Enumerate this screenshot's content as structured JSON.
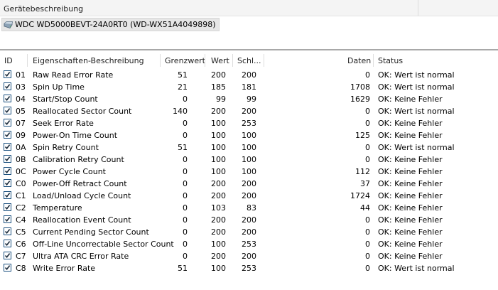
{
  "header": {
    "title": "Gerätebeschreibung"
  },
  "device": {
    "name": "WDC WD5000BEVT-24A0RT0 (WD-WX51A4049898)",
    "icon": "hard-drive-icon"
  },
  "columns": {
    "id": "ID",
    "description": "Eigenschaften-Beschreibung",
    "threshold": "Grenzwert",
    "value": "Wert",
    "worst": "Schl...",
    "data": "Daten",
    "status": "Status"
  },
  "rows": [
    {
      "id": "01",
      "desc": "Raw Read Error Rate",
      "thr": "51",
      "val": "200",
      "worst": "200",
      "data": "0",
      "status": "OK: Wert ist normal",
      "checked": true
    },
    {
      "id": "03",
      "desc": "Spin Up Time",
      "thr": "21",
      "val": "185",
      "worst": "181",
      "data": "1708",
      "status": "OK: Wert ist normal",
      "checked": true
    },
    {
      "id": "04",
      "desc": "Start/Stop Count",
      "thr": "0",
      "val": "99",
      "worst": "99",
      "data": "1629",
      "status": "OK: Keine Fehler",
      "checked": true
    },
    {
      "id": "05",
      "desc": "Reallocated Sector Count",
      "thr": "140",
      "val": "200",
      "worst": "200",
      "data": "0",
      "status": "OK: Wert ist normal",
      "checked": true
    },
    {
      "id": "07",
      "desc": "Seek Error Rate",
      "thr": "0",
      "val": "100",
      "worst": "253",
      "data": "0",
      "status": "OK: Keine Fehler",
      "checked": true
    },
    {
      "id": "09",
      "desc": "Power-On Time Count",
      "thr": "0",
      "val": "100",
      "worst": "100",
      "data": "125",
      "status": "OK: Keine Fehler",
      "checked": true
    },
    {
      "id": "0A",
      "desc": "Spin Retry Count",
      "thr": "51",
      "val": "100",
      "worst": "100",
      "data": "0",
      "status": "OK: Wert ist normal",
      "checked": true
    },
    {
      "id": "0B",
      "desc": "Calibration Retry Count",
      "thr": "0",
      "val": "100",
      "worst": "100",
      "data": "0",
      "status": "OK: Keine Fehler",
      "checked": true
    },
    {
      "id": "0C",
      "desc": "Power Cycle Count",
      "thr": "0",
      "val": "100",
      "worst": "100",
      "data": "112",
      "status": "OK: Keine Fehler",
      "checked": true
    },
    {
      "id": "C0",
      "desc": "Power-Off Retract Count",
      "thr": "0",
      "val": "200",
      "worst": "200",
      "data": "37",
      "status": "OK: Keine Fehler",
      "checked": true
    },
    {
      "id": "C1",
      "desc": "Load/Unload Cycle Count",
      "thr": "0",
      "val": "200",
      "worst": "200",
      "data": "1724",
      "status": "OK: Keine Fehler",
      "checked": true
    },
    {
      "id": "C2",
      "desc": "Temperature",
      "thr": "0",
      "val": "103",
      "worst": "83",
      "data": "44",
      "status": "OK: Keine Fehler",
      "checked": true
    },
    {
      "id": "C4",
      "desc": "Reallocation Event Count",
      "thr": "0",
      "val": "200",
      "worst": "200",
      "data": "0",
      "status": "OK: Keine Fehler",
      "checked": true
    },
    {
      "id": "C5",
      "desc": "Current Pending Sector Count",
      "thr": "0",
      "val": "200",
      "worst": "200",
      "data": "0",
      "status": "OK: Keine Fehler",
      "checked": true
    },
    {
      "id": "C6",
      "desc": "Off-Line Uncorrectable Sector Count",
      "thr": "0",
      "val": "100",
      "worst": "253",
      "data": "0",
      "status": "OK: Keine Fehler",
      "checked": true
    },
    {
      "id": "C7",
      "desc": "Ultra ATA CRC Error Rate",
      "thr": "0",
      "val": "200",
      "worst": "200",
      "data": "0",
      "status": "OK: Keine Fehler",
      "checked": true
    },
    {
      "id": "C8",
      "desc": "Write Error Rate",
      "thr": "51",
      "val": "100",
      "worst": "253",
      "data": "0",
      "status": "OK: Wert ist normal",
      "checked": true
    }
  ]
}
